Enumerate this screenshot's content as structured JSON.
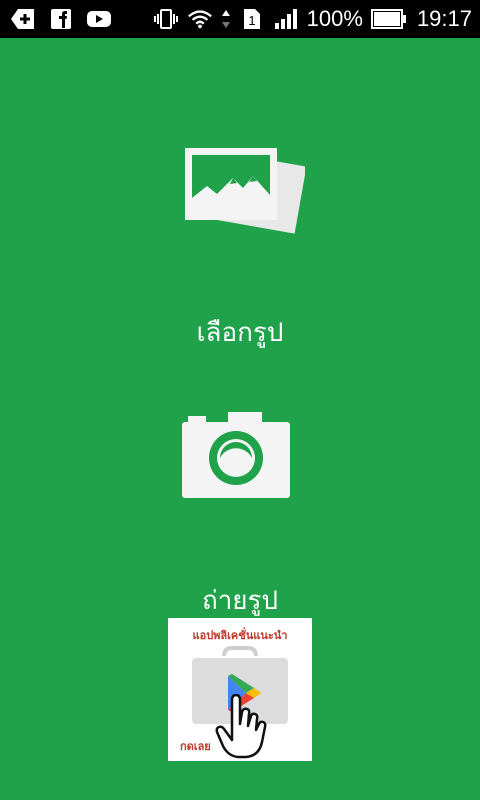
{
  "status_bar": {
    "left_icons": [
      "add-icon",
      "facebook-icon",
      "youtube-icon"
    ],
    "battery_percent": "100%",
    "battery_level": 1.0,
    "sim_slot": "1",
    "time": "19:17"
  },
  "actions": {
    "choose_photo": {
      "label": "เลือกรูป",
      "icon": "gallery-icon"
    },
    "take_photo": {
      "label": "ถ่ายรูป",
      "icon": "camera-icon"
    }
  },
  "ad": {
    "title": "แอปพลิเคชั่นแนะนำ",
    "cta": "กดเลย",
    "icon": "play-store-icon"
  },
  "colors": {
    "background": "#1fa24a",
    "status_bar": "#000000",
    "icon": "#f2f2f2"
  }
}
